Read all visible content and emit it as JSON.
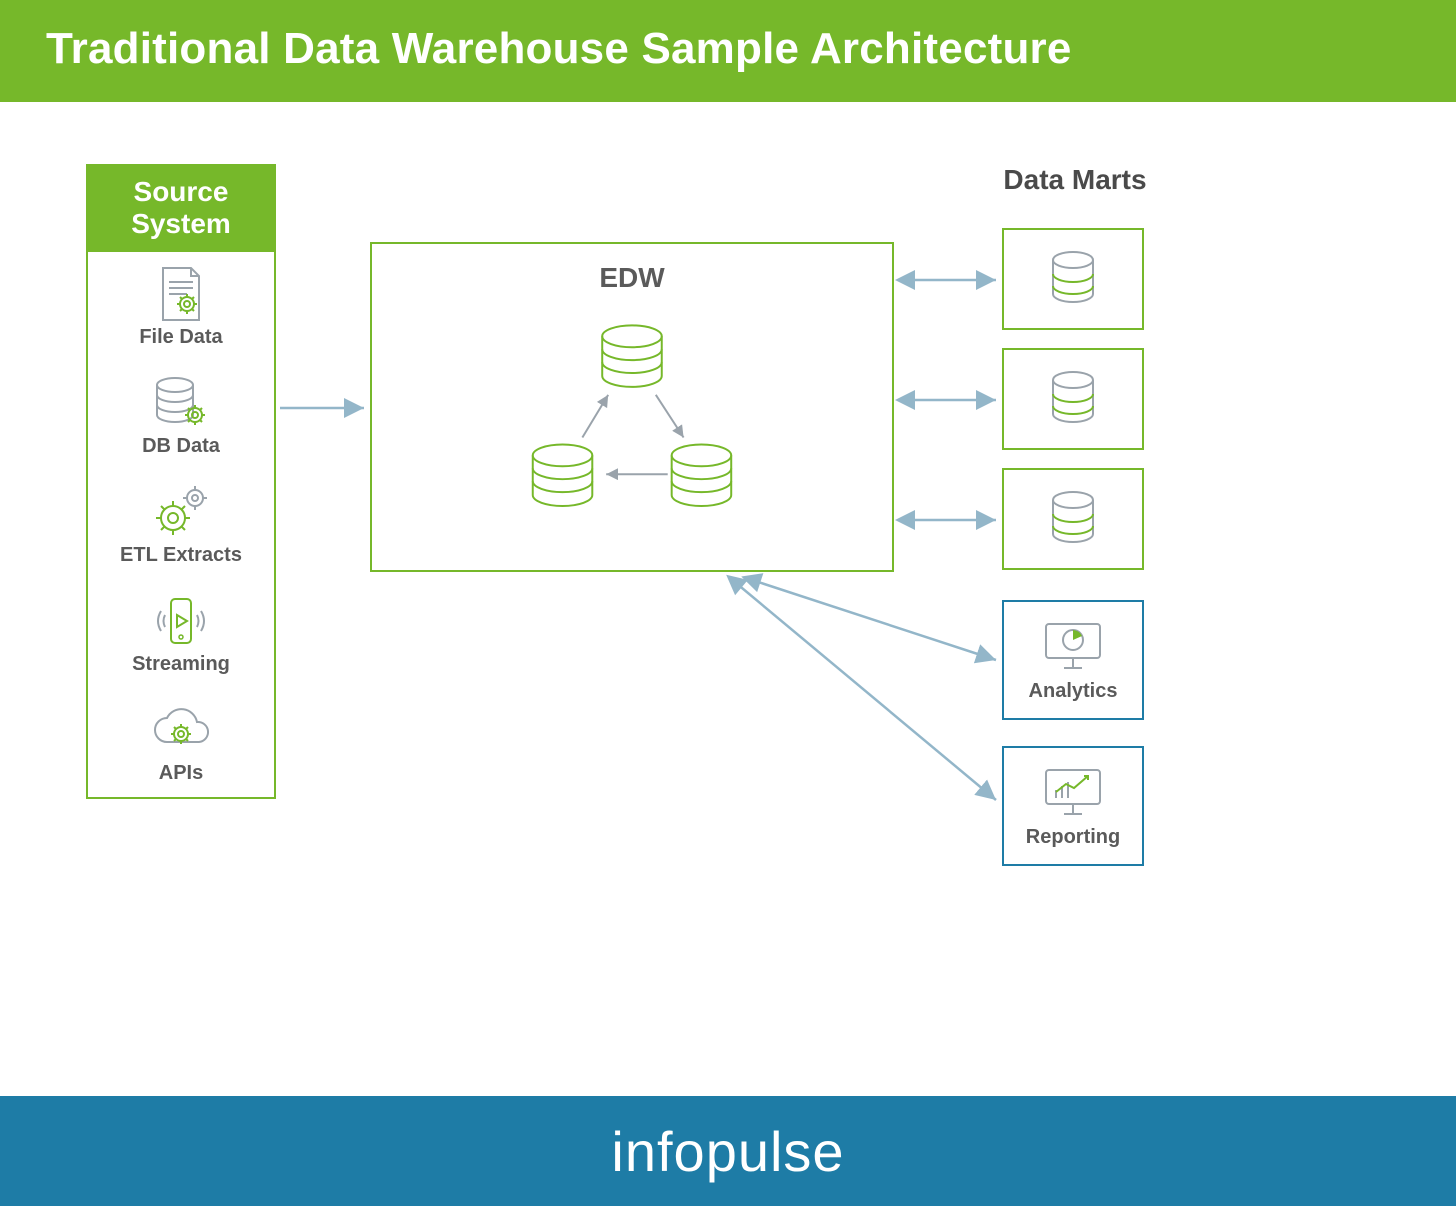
{
  "header": {
    "title": "Traditional Data Warehouse Sample Architecture"
  },
  "footer": {
    "brand": "infopulse"
  },
  "sourceSystem": {
    "title_line1": "Source",
    "title_line2": "System",
    "items": [
      {
        "label": "File Data"
      },
      {
        "label": "DB Data"
      },
      {
        "label": "ETL Extracts"
      },
      {
        "label": "Streaming"
      },
      {
        "label": "APIs"
      }
    ]
  },
  "edw": {
    "label": "EDW"
  },
  "dataMarts": {
    "title": "Data Marts"
  },
  "consumers": {
    "analytics_label": "Analytics",
    "reporting_label": "Reporting"
  },
  "colors": {
    "green": "#76b82a",
    "blue": "#1e7ca6",
    "grey": "#9aa3ab",
    "text": "#5a5a5a"
  }
}
